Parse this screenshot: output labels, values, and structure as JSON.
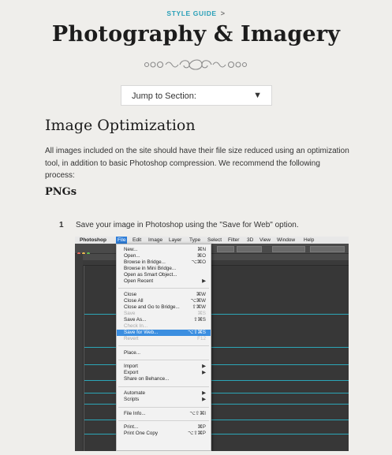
{
  "breadcrumb": {
    "label": "STYLE GUIDE",
    "chevron": ">"
  },
  "page_title": "Photography & Imagery",
  "jump": {
    "label": "Jump to Section:",
    "arrow": "▼"
  },
  "section_title": "Image Optimization",
  "intro": "All images included on the site should have their file size reduced using an optimization tool, in addition to basic Photoshop compression. We recommend the following process:",
  "subsection": "PNGs",
  "steps": [
    {
      "num": "1",
      "text": "Save your image in Photoshop using the \"Save for Web\" option."
    }
  ],
  "screenshot": {
    "menubar": [
      "Photoshop",
      "File",
      "Edit",
      "Image",
      "Layer",
      "Type",
      "Select",
      "Filter",
      "3D",
      "View",
      "Window",
      "Help"
    ],
    "menu_items": [
      {
        "label": "New...",
        "key": "⌘N"
      },
      {
        "label": "Open...",
        "key": "⌘O"
      },
      {
        "label": "Browse in Bridge...",
        "key": "⌥⌘O"
      },
      {
        "label": "Browse in Mini Bridge...",
        "key": ""
      },
      {
        "label": "Open as Smart Object...",
        "key": ""
      },
      {
        "label": "Open Recent",
        "key": "▶"
      },
      {
        "label": "Close",
        "key": "⌘W"
      },
      {
        "label": "Close All",
        "key": "⌥⌘W"
      },
      {
        "label": "Close and Go to Bridge...",
        "key": "⇧⌘W"
      },
      {
        "label": "Save",
        "key": "⌘S"
      },
      {
        "label": "Save As...",
        "key": "⇧⌘S"
      },
      {
        "label": "Check In...",
        "key": ""
      },
      {
        "label": "Save for Web...",
        "key": "⌥⇧⌘S"
      },
      {
        "label": "Revert",
        "key": "F12"
      },
      {
        "label": "Place...",
        "key": ""
      },
      {
        "label": "Import",
        "key": "▶"
      },
      {
        "label": "Export",
        "key": "▶"
      },
      {
        "label": "Share on Behance...",
        "key": ""
      },
      {
        "label": "Automate",
        "key": "▶"
      },
      {
        "label": "Scripts",
        "key": "▶"
      },
      {
        "label": "File Info...",
        "key": "⌥⇧⌘I"
      },
      {
        "label": "Print...",
        "key": "⌘P"
      },
      {
        "label": "Print One Copy",
        "key": "⌥⇧⌘P"
      }
    ]
  }
}
